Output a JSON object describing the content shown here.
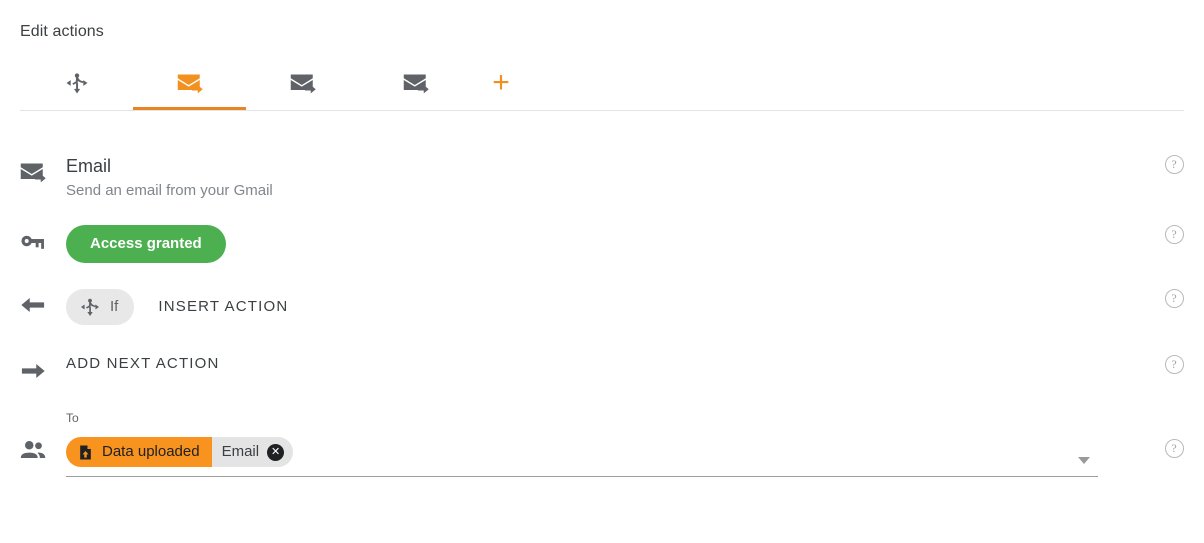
{
  "header": {
    "title": "Edit actions"
  },
  "tabs": {
    "items": [
      {
        "id": "tab-branch",
        "icon": "branch-arrows-icon",
        "active": false,
        "color": "#5f6368"
      },
      {
        "id": "tab-email-1",
        "icon": "email-send-icon",
        "active": true,
        "color": "#f2911f"
      },
      {
        "id": "tab-email-2",
        "icon": "email-send-icon",
        "active": false,
        "color": "#5f6368"
      },
      {
        "id": "tab-email-3",
        "icon": "email-send-icon",
        "active": false,
        "color": "#5f6368"
      }
    ],
    "add_label": "+",
    "active_underline_color": "#e88522"
  },
  "rows": {
    "email": {
      "gutter_icon": "email-send-icon",
      "title": "Email",
      "subtitle": "Send an email from your Gmail",
      "help": "?"
    },
    "access": {
      "gutter_icon": "key-icon",
      "button_label": "Access granted",
      "button_color": "#4cb050",
      "help": "?"
    },
    "insert": {
      "gutter_icon": "arrow-left-icon",
      "pill_icon": "branch-arrows-icon",
      "pill_label": "If",
      "action_label": "INSERT ACTION",
      "help": "?"
    },
    "add_next": {
      "gutter_icon": "arrow-right-icon",
      "action_label": "ADD NEXT ACTION",
      "help": "?"
    },
    "to": {
      "gutter_icon": "people-icon",
      "field_label": "To",
      "chip": {
        "icon": "file-upload-icon",
        "source_label": "Data uploaded",
        "field_label": "Email",
        "remove_label": "✕",
        "source_color": "#f7931e",
        "field_color": "#e4e4e4"
      },
      "dropdown_icon": "chevron-down-icon",
      "help": "?"
    }
  }
}
